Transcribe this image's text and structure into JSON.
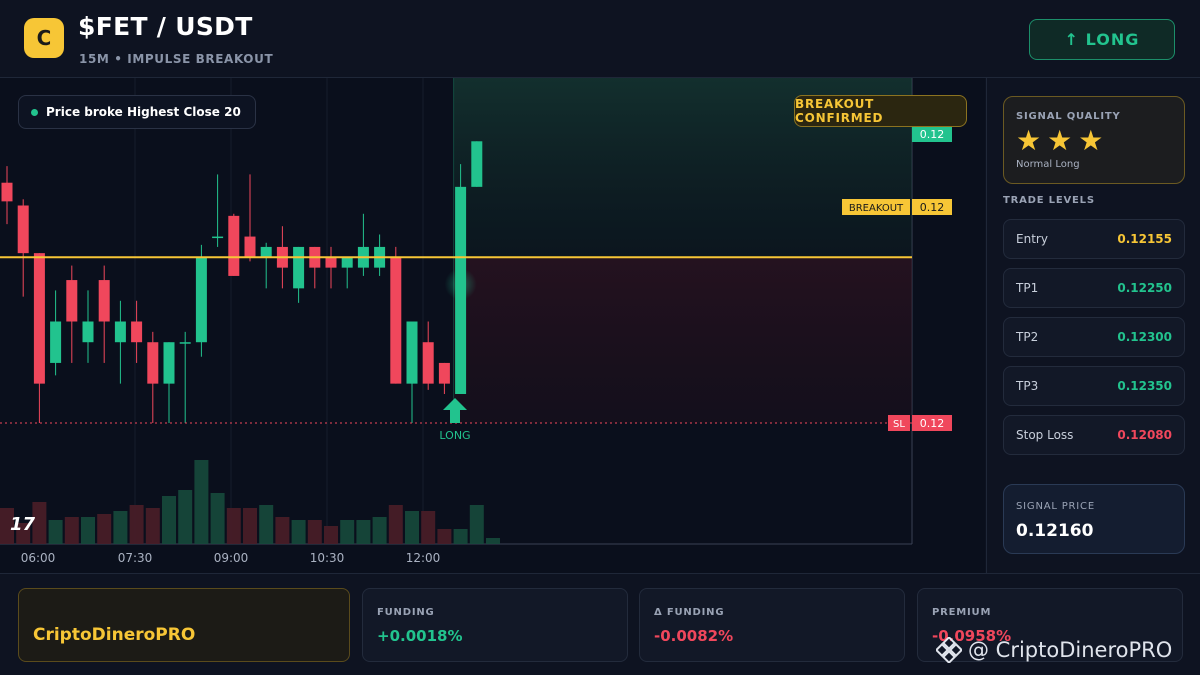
{
  "header": {
    "logo_letter": "C",
    "title": "$FET / USDT",
    "subtitle": "15M • IMPULSE BREAKOUT",
    "signal_button": "↑ LONG"
  },
  "chart_overlay": {
    "note": "Price broke Highest Close 20",
    "confirmed_badge": "BREAKOUT CONFIRMED",
    "top_tag_price": "0.12",
    "breakout_label": "BREAKOUT",
    "breakout_price": "0.12",
    "sl_label": "SL",
    "sl_price": "0.12",
    "long_marker": "LONG",
    "tv_logo": "17"
  },
  "colors": {
    "up": "#22c38e",
    "down": "#f0475c",
    "accent": "#f7c636",
    "background": "#0a0f1c"
  },
  "chart_data": {
    "type": "candlestick",
    "timeframe": "15M",
    "x_tick_labels": [
      "06:00",
      "07:30",
      "09:00",
      "10:30",
      "12:00"
    ],
    "price_levels": {
      "entry": 0.12155,
      "tp1": 0.1225,
      "tp2": 0.123,
      "tp3": 0.1235,
      "stop_loss": 0.1208,
      "breakout": 0.1216
    },
    "candles": [
      {
        "o": 0.12196,
        "h": 0.12204,
        "l": 0.12176,
        "c": 0.12187
      },
      {
        "o": 0.12185,
        "h": 0.12188,
        "l": 0.12141,
        "c": 0.12162
      },
      {
        "o": 0.12162,
        "h": 0.12162,
        "l": 0.1208,
        "c": 0.12099
      },
      {
        "o": 0.12109,
        "h": 0.12144,
        "l": 0.12103,
        "c": 0.12129
      },
      {
        "o": 0.12149,
        "h": 0.12156,
        "l": 0.12109,
        "c": 0.12129
      },
      {
        "o": 0.12119,
        "h": 0.12144,
        "l": 0.12109,
        "c": 0.12129
      },
      {
        "o": 0.12149,
        "h": 0.12156,
        "l": 0.12109,
        "c": 0.12129
      },
      {
        "o": 0.12119,
        "h": 0.12139,
        "l": 0.12099,
        "c": 0.12129
      },
      {
        "o": 0.12129,
        "h": 0.12139,
        "l": 0.12109,
        "c": 0.12119
      },
      {
        "o": 0.12119,
        "h": 0.12124,
        "l": 0.1208,
        "c": 0.12099
      },
      {
        "o": 0.12099,
        "h": 0.12119,
        "l": 0.1208,
        "c": 0.12119
      },
      {
        "o": 0.12119,
        "h": 0.12124,
        "l": 0.1208,
        "c": 0.12119
      },
      {
        "o": 0.12119,
        "h": 0.12166,
        "l": 0.12112,
        "c": 0.1216
      },
      {
        "o": 0.1217,
        "h": 0.122,
        "l": 0.12165,
        "c": 0.1217
      },
      {
        "o": 0.1218,
        "h": 0.12181,
        "l": 0.12151,
        "c": 0.12151
      },
      {
        "o": 0.1217,
        "h": 0.122,
        "l": 0.12158,
        "c": 0.1216
      },
      {
        "o": 0.1216,
        "h": 0.12167,
        "l": 0.12145,
        "c": 0.12165
      },
      {
        "o": 0.12165,
        "h": 0.12175,
        "l": 0.12145,
        "c": 0.12155
      },
      {
        "o": 0.12145,
        "h": 0.12165,
        "l": 0.12138,
        "c": 0.12165
      },
      {
        "o": 0.12165,
        "h": 0.12165,
        "l": 0.12145,
        "c": 0.12155
      },
      {
        "o": 0.1216,
        "h": 0.12165,
        "l": 0.12145,
        "c": 0.12155
      },
      {
        "o": 0.12155,
        "h": 0.1216,
        "l": 0.12145,
        "c": 0.1216
      },
      {
        "o": 0.12155,
        "h": 0.12181,
        "l": 0.12151,
        "c": 0.12165
      },
      {
        "o": 0.12155,
        "h": 0.12171,
        "l": 0.12151,
        "c": 0.12165
      },
      {
        "o": 0.1216,
        "h": 0.12165,
        "l": 0.12099,
        "c": 0.12099
      },
      {
        "o": 0.12099,
        "h": 0.12129,
        "l": 0.1208,
        "c": 0.12129
      },
      {
        "o": 0.12119,
        "h": 0.12129,
        "l": 0.12096,
        "c": 0.12099
      },
      {
        "o": 0.12109,
        "h": 0.12109,
        "l": 0.12094,
        "c": 0.12099
      },
      {
        "o": 0.12094,
        "h": 0.12205,
        "l": 0.12094,
        "c": 0.12194
      },
      {
        "o": 0.12194,
        "h": 0.12216,
        "l": 0.12194,
        "c": 0.12216
      }
    ],
    "volumes": [
      12,
      7,
      14,
      8,
      9,
      9,
      10,
      11,
      13,
      12,
      16,
      18,
      28,
      17,
      12,
      12,
      13,
      9,
      8,
      8,
      6,
      8,
      8,
      9,
      13,
      11,
      11,
      5,
      5,
      13,
      2
    ]
  },
  "panel": {
    "quality_label": "SIGNAL QUALITY",
    "stars": [
      "★",
      "★",
      "★"
    ],
    "quality_text": "Normal Long",
    "levels_label": "TRADE LEVELS",
    "levels": [
      {
        "name": "Entry",
        "value": "0.12155",
        "color": "#f7c636"
      },
      {
        "name": "TP1",
        "value": "0.12250",
        "color": "#22c38e"
      },
      {
        "name": "TP2",
        "value": "0.12300",
        "color": "#22c38e"
      },
      {
        "name": "TP3",
        "value": "0.12350",
        "color": "#22c38e"
      },
      {
        "name": "Stop Loss",
        "value": "0.12080",
        "color": "#f0475c"
      }
    ],
    "signal_price_label": "SIGNAL PRICE",
    "signal_price": "0.12160"
  },
  "footer": {
    "brand": "CriptoDineroPRO",
    "stats": [
      {
        "label": "FUNDING",
        "value": "+0.0018%",
        "color": "#22c38e"
      },
      {
        "label": "Δ FUNDING",
        "value": "-0.0082%",
        "color": "#f0475c"
      },
      {
        "label": "PREMIUM",
        "value": "-0.0958%",
        "color": "#f0475c"
      }
    ],
    "watermark": "@ CriptoDineroPRO",
    "watermark_icon": "binance-icon"
  }
}
